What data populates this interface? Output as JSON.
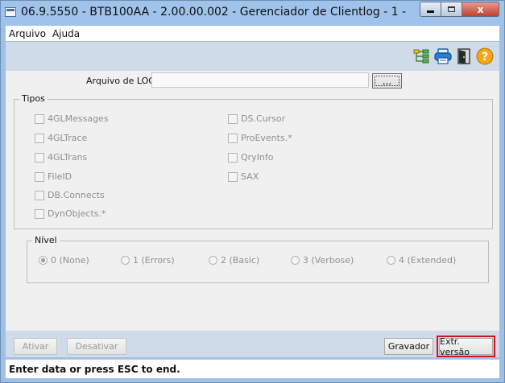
{
  "window": {
    "title": "06.9.5550 - BTB100AA - 2.00.00.002 - Gerenciador de Clientlog - 1 -",
    "minimize": "minimize",
    "maximize": "maximize",
    "close": "x"
  },
  "menu": {
    "items": [
      {
        "label": "Arquivo"
      },
      {
        "label": "Ajuda"
      }
    ]
  },
  "toolbar": {
    "icons": [
      "tree-icon",
      "printer-icon",
      "exit-door-icon",
      "help-icon"
    ]
  },
  "form": {
    "log_label": "Arquivo de LOG:",
    "log_value": "",
    "browse_label": "...",
    "tipos": {
      "title": "Tipos",
      "left": [
        {
          "label": "4GLMessages",
          "checked": false
        },
        {
          "label": "4GLTrace",
          "checked": false
        },
        {
          "label": "4GLTrans",
          "checked": false
        },
        {
          "label": "FileID",
          "checked": false
        },
        {
          "label": "DB.Connects",
          "checked": false
        },
        {
          "label": "DynObjects.*",
          "checked": false
        }
      ],
      "right": [
        {
          "label": "DS.Cursor",
          "checked": false
        },
        {
          "label": "ProEvents.*",
          "checked": false
        },
        {
          "label": "QryInfo",
          "checked": false
        },
        {
          "label": "SAX",
          "checked": false
        }
      ]
    },
    "nivel": {
      "title": "Nível",
      "options": [
        {
          "label": "0 (None)",
          "selected": true
        },
        {
          "label": "1 (Errors)",
          "selected": false
        },
        {
          "label": "2 (Basic)",
          "selected": false
        },
        {
          "label": "3 (Verbose)",
          "selected": false
        },
        {
          "label": "4 (Extended)",
          "selected": false
        }
      ]
    }
  },
  "buttons": {
    "ativar": "Ativar",
    "desativar": "Desativar",
    "gravador": "Gravador",
    "extr_versao": "Extr. versão"
  },
  "status": {
    "text": "Enter data or press ESC to end."
  },
  "colors": {
    "highlight": "#d4141b",
    "titlebar": "#9fc3ea",
    "toolbar": "#cfdbe8"
  }
}
